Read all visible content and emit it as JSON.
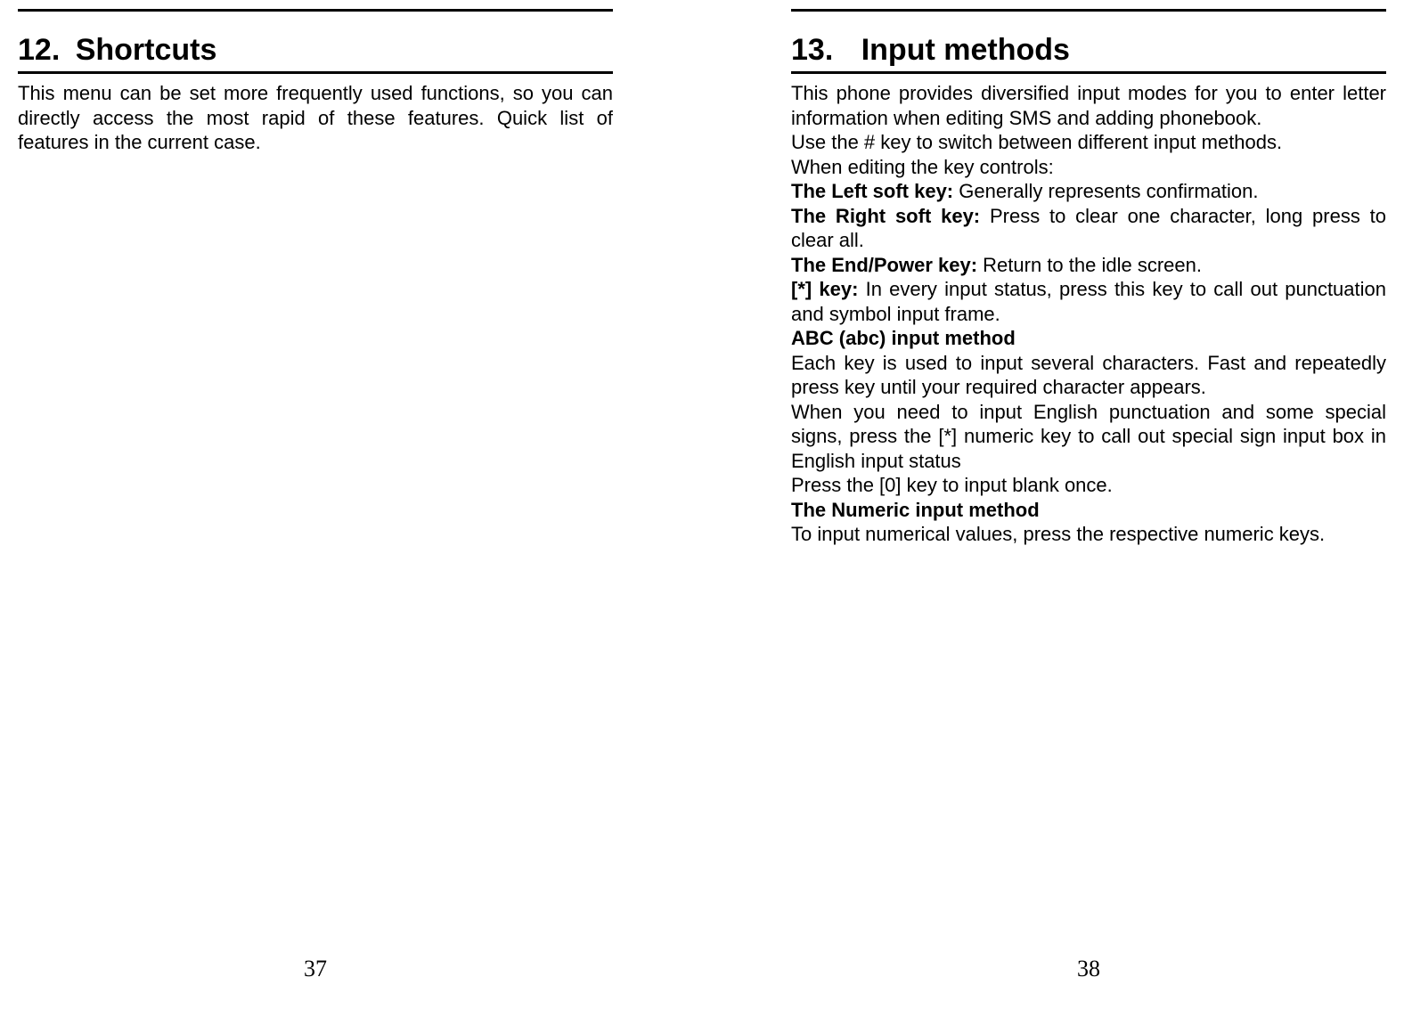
{
  "left": {
    "heading_num": "12.",
    "heading_title": "Shortcuts",
    "para1": "This menu can be set more frequently used functions, so you can directly access the most rapid of these features. Quick list of features in the current case.",
    "page_num": "37"
  },
  "right": {
    "heading_num": "13.",
    "heading_title": "Input methods",
    "intro": "This phone provides diversified input modes for you to enter letter information when editing SMS and adding phonebook.",
    "hash_line": "Use the # key to switch between different input methods.",
    "editing_line": "When editing the key controls:",
    "left_soft_label": "The Left soft key: ",
    "left_soft_text": "Generally represents confirmation.",
    "right_soft_label": "The Right soft key: ",
    "right_soft_text": "Press to clear one character, long press to clear all.",
    "end_power_label": "The End/Power key: ",
    "end_power_text": "Return to the idle screen.",
    "star_label": "[*] key: ",
    "star_text": "In every input status, press this key to call out punctuation and symbol input frame.",
    "abc_heading": "ABC (abc) input method",
    "abc_p1": "Each key is used to input several characters. Fast and repeatedly press key until your required character appears.",
    "abc_p2": "When you need to input English punctuation and some special signs, press the [*] numeric key to call out special sign input box in English input status",
    "abc_p3": "Press the [0] key to input blank once.",
    "numeric_heading": "The Numeric input method",
    "numeric_p1": "To input numerical values, press the respective numeric keys.",
    "page_num": "38"
  }
}
